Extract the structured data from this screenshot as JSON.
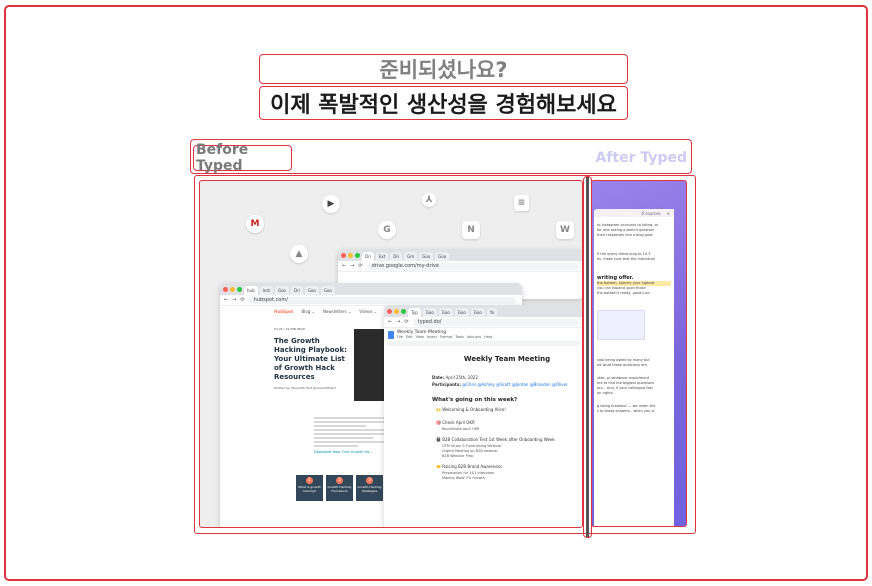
{
  "hero": {
    "kicker": "준비되셨나요?",
    "headline": "이제 폭발적인 생산성을 경험해보세요"
  },
  "compare": {
    "before_label": "Before Typed",
    "after_label": "After Typed"
  },
  "app_icons": [
    "gmail-icon",
    "youtube-icon",
    "acrobat-icon",
    "docs-icon",
    "google-icon",
    "notion-icon",
    "word-icon",
    "drive-icon"
  ],
  "drive_window": {
    "tabs": [
      "Dri",
      "Ext",
      "Dri",
      "Gm",
      "Goo",
      "Goo"
    ],
    "url": "drive.google.com/my-drive"
  },
  "hubspot_window": {
    "tabs": [
      "hub",
      "Inst",
      "Goo",
      "Dri",
      "Goo",
      "Goo"
    ],
    "url": "hubspot.com/",
    "nav_logo": "HubSpot",
    "nav_items": [
      "Blog ⌄",
      "Newsletters ⌄",
      "Videos ⌄",
      "Podcasts"
    ],
    "date": "04.05 | 19 MIN READ",
    "article_title": "The Growth Hacking Playbook: Your Ultimate List of Growth Hack Resources",
    "author": "Written by: Meredith Hart  @meredithhart",
    "cta": "Download Now: Free Growth Ha...",
    "cards": [
      {
        "num": "1",
        "label": "What is growth hacking?"
      },
      {
        "num": "2",
        "label": "Growth Hacking Framework"
      },
      {
        "num": "3",
        "label": "Growth Hacking Strategies"
      }
    ]
  },
  "typed_window": {
    "tabs": [
      "Typ",
      "Goo",
      "Goo",
      "Goo",
      "Goo",
      "Yo"
    ],
    "url": "typed.do/",
    "doc_name": "Weekly Team Meeting",
    "menu": [
      "File",
      "Edit",
      "View",
      "Insert",
      "Format",
      "Tools",
      "Add-ons",
      "Help"
    ],
    "doc_title": "Weekly Team Meeting",
    "date_label": "Date:",
    "date_value": "April 25th, 2022",
    "participants_label": "Participants:",
    "participants_value": "@Chris @Ashley @Scott @Jordan @Brandon @Oliver",
    "section_heading": "What's going on this week?",
    "items": [
      {
        "heading": "🙌 Welcoming & Onboarding Alice!",
        "subs": []
      },
      {
        "heading": "🎯 Check April OKR",
        "subs": [
          "Recalibrate April OKR"
        ]
      },
      {
        "heading": "📓 B2B Collaboration Test 1st Week after Onboarding Week",
        "subs": [
          "GTM Study & Fundraising Webinar",
          "Urgent Meeting on B2B webinar",
          "B2B Webinar Prep"
        ]
      },
      {
        "heading": "🤝 Raising B2B Brand Awareness",
        "subs": [
          "Preparation for 1&1 interview",
          "Making WoW 7% Growth"
        ]
      }
    ]
  },
  "after": {
    "toolbar": "6 sources",
    "heading_fragment": "writing offer.",
    "highlight": "the bottom, Specify your highest",
    "texts": [
      "to Instagram accounts to follow, or",
      "for and asking a sketch question",
      "their responses into a blog post.",
      "If the query these quip to 14.3",
      "es, make sure that the individual",
      "you can expand upon those",
      "the bottom's ready, good luck.",
      "cool being asked by many but",
      "ed what those questions are.",
      "ideo, or whatever experiment",
      "ere to find the biggest questions",
      "ers... And, if your colleague feel",
      "on rights.",
      "g being breakout — we mean the",
      "s to those answers - when you vi"
    ]
  }
}
